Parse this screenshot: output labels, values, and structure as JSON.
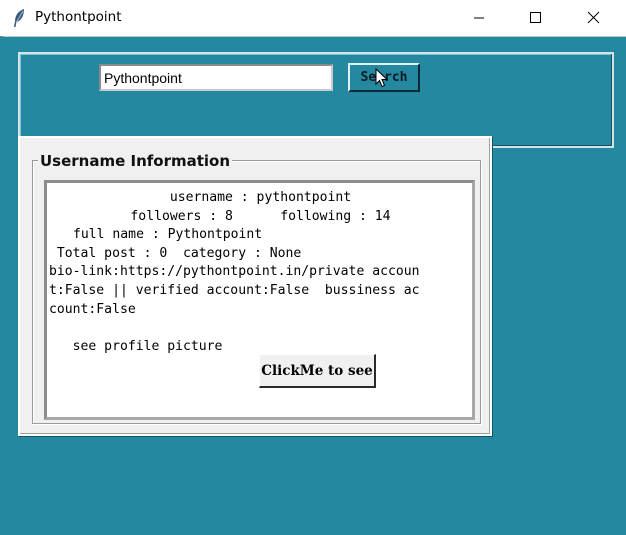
{
  "window": {
    "title": "Pythontpoint",
    "controls": [
      "minimize",
      "maximize",
      "close"
    ]
  },
  "search": {
    "value": "Pythontpoint",
    "button_label": "Search"
  },
  "info_panel": {
    "group_label": "Username Information",
    "lines": [
      "username : pythontpoint",
      "followers : 8      following : 14",
      "full name : Pythontpoint",
      " Total post : 0  category : None",
      "bio-link:https://pythontpoint.in/private accoun",
      "t:False || verified account:False  bussiness ac",
      "count:False",
      "",
      "   see profile picture"
    ],
    "button_label": "ClickMe to see"
  },
  "icons": {
    "app": "feather-icon",
    "cursor": "mouse-pointer-icon"
  },
  "colors": {
    "background": "#2388a0",
    "panel": "#f0f0f0"
  }
}
